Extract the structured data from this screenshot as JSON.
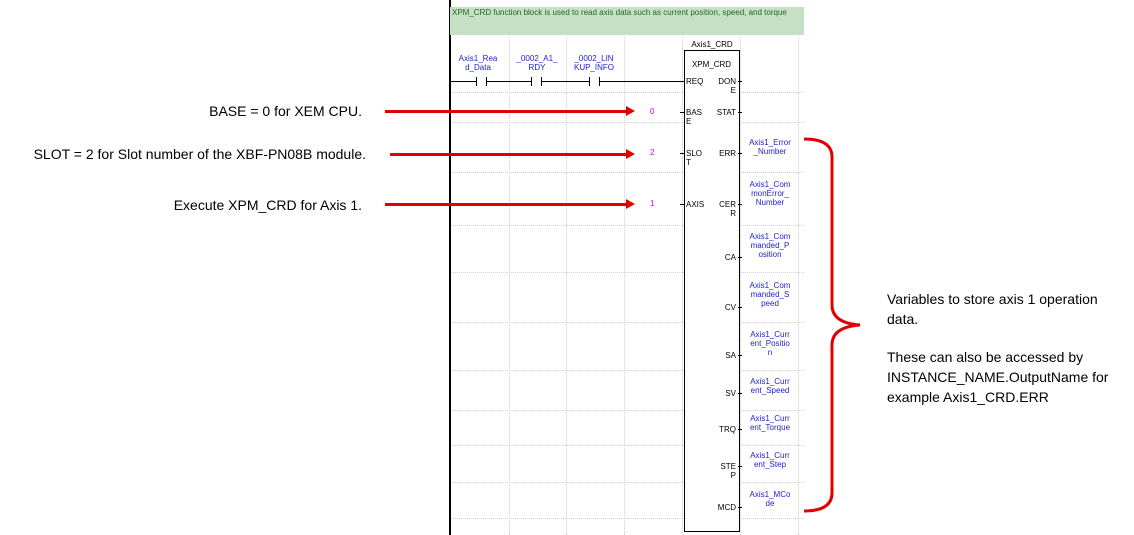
{
  "comment": "XPM_CRD function block is used to read axis data such as current position, speed, and torque",
  "contacts": [
    {
      "label": "Axis1_Rea\nd_Data"
    },
    {
      "label": "_0002_A1_\nRDY"
    },
    {
      "label": "_0002_LIN\nKUP_INFO"
    }
  ],
  "fb": {
    "instance_name": "Axis1_CRD",
    "type_name": "XPM_CRD",
    "inputs": [
      {
        "pin": "REQ",
        "value": ""
      },
      {
        "pin": "BAS\nE",
        "value": "0"
      },
      {
        "pin": "SLO\nT",
        "value": "2"
      },
      {
        "pin": "AXIS",
        "value": "1"
      }
    ],
    "outputs": [
      {
        "pin": "DON\nE",
        "var": ""
      },
      {
        "pin": "STAT",
        "var": ""
      },
      {
        "pin": "ERR",
        "var": "Axis1_Error\n_Number"
      },
      {
        "pin": "CER\nR",
        "var": "Axis1_Com\nmonError_\nNumber"
      },
      {
        "pin": "CA",
        "var": "Axis1_Com\nmanded_P\nosition"
      },
      {
        "pin": "CV",
        "var": "Axis1_Com\nmanded_S\npeed"
      },
      {
        "pin": "SA",
        "var": "Axis1_Curr\nent_Positio\nn"
      },
      {
        "pin": "SV",
        "var": "Axis1_Curr\nent_Speed"
      },
      {
        "pin": "TRQ",
        "var": "Axis1_Curr\nent_Torque"
      },
      {
        "pin": "STE\nP",
        "var": "Axis1_Curr\nent_Step"
      },
      {
        "pin": "MCD",
        "var": "Axis1_MCo\nde"
      }
    ]
  },
  "annotations": {
    "base": "BASE = 0 for XEM CPU.",
    "slot": "SLOT = 2 for Slot number of the XBF-PN08B module.",
    "axis": "Execute XPM_CRD for Axis 1.",
    "right_note_line1": "Variables to store axis 1 operation data.",
    "right_note_line2": "These can also be accessed by INSTANCE_NAME.OutputName for example Axis1_CRD.ERR"
  },
  "colors": {
    "annotation_arrow": "#e00000",
    "constant": "#e000e0",
    "variable": "#2222cc",
    "comment_bg": "#c6e0c6"
  }
}
